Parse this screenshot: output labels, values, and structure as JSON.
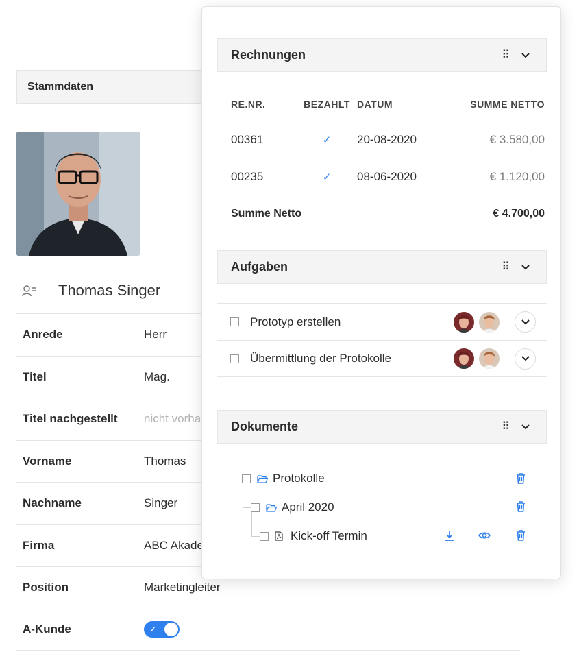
{
  "stammdaten": {
    "title": "Stammdaten"
  },
  "contact": {
    "name": "Thomas Singer",
    "fields": [
      {
        "label": "Anrede",
        "value": "Herr"
      },
      {
        "label": "Titel",
        "value": "Mag."
      },
      {
        "label": "Titel nachgestellt",
        "value": "nicht vorha",
        "muted": true
      },
      {
        "label": "Vorname",
        "value": "Thomas"
      },
      {
        "label": "Nachname",
        "value": "Singer"
      },
      {
        "label": "Firma",
        "value": "ABC Akade"
      },
      {
        "label": "Position",
        "value": "Marketingleiter"
      },
      {
        "label": "A-Kunde",
        "toggle_on": true
      }
    ]
  },
  "invoices": {
    "title": "Rechnungen",
    "columns": [
      "RE.NR.",
      "BEZAHLT",
      "DATUM",
      "SUMME NETTO"
    ],
    "rows": [
      {
        "nr": "00361",
        "paid": "✓",
        "date": "20-08-2020",
        "sum": "€ 3.580,00"
      },
      {
        "nr": "00235",
        "paid": "✓",
        "date": "08-06-2020",
        "sum": "€ 1.120,00"
      }
    ],
    "total_label": "Summe Netto",
    "total_value": "€ 4.700,00"
  },
  "tasks": {
    "title": "Aufgaben",
    "items": [
      {
        "label": "Prototyp erstellen"
      },
      {
        "label": "Übermittlung der Protokolle"
      }
    ]
  },
  "documents": {
    "title": "Dokumente",
    "items": [
      {
        "label": "Protokolle",
        "icon": "folder-open-icon"
      },
      {
        "label": "April 2020",
        "icon": "folder-open-icon"
      },
      {
        "label": "Kick-off Termin",
        "icon": "pdf-file-icon"
      }
    ]
  },
  "colors": {
    "accent": "#2f80ed",
    "section_bg": "#f4f4f4",
    "border": "#e6e6e6"
  }
}
